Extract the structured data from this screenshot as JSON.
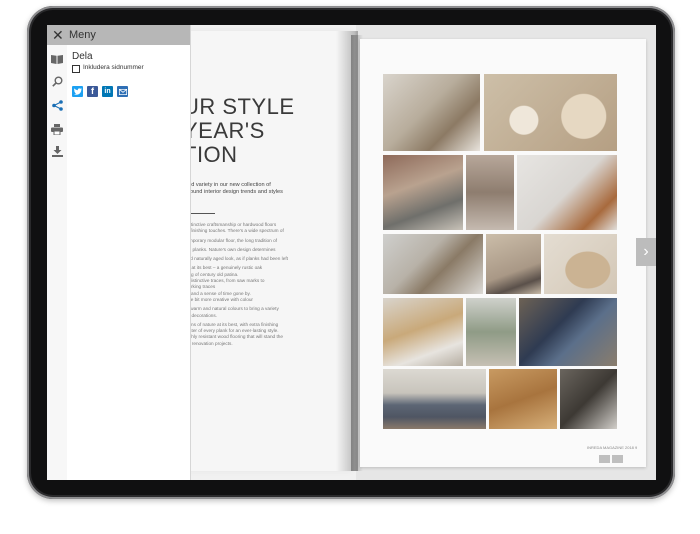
{
  "menu": {
    "title": "Meny",
    "close_icon": "close-icon",
    "section_title": "Dela",
    "checkbox_label": "Inkludera sidnummer",
    "checkbox_checked": false,
    "side_icons": [
      "book-icon",
      "search-icon",
      "share-icon",
      "print-icon",
      "download-icon"
    ],
    "share_buttons": [
      {
        "icon": "twitter-icon",
        "color": "#1da1f2"
      },
      {
        "icon": "facebook-icon",
        "color": "#3b5998"
      },
      {
        "icon": "linkedin-icon",
        "color": "#0077b5"
      },
      {
        "icon": "email-icon",
        "color": "#2f6fb5"
      }
    ],
    "accent_color": "#1a6fb5"
  },
  "left_page": {
    "headline": "UR STYLE\nYEAR'S\nTION",
    "intro": "and variety in our new collection of\naround interior design trends and styles",
    "paragraphs": [
      "distinctive craftsmanship or hardwood floors\nof finishing touches. There's a wide spectrum of",
      "temporary modular floor, the long tradition of",
      "ing planks. Nature's own design determines",
      "and naturally aged look, as if planks had been left",
      "ng at its best – a genuinely rustic oak\nking of century old patina.\nd distinctive traces, from saw marks to\nworking traces\nity and a sense of time gone by.\nlittle bit more creative with colour",
      "of warm and natural colours to bring a variety\nior decorations.",
      "signs of nature at its best, with extra finishing\nracter of every plank for an ever-lasting style.\nhighly resistant wood flooring that will stand the\nfor renovation projects."
    ]
  },
  "right_page": {
    "footer": "INREDA MAGAZINE 2018",
    "page_number": "9",
    "next_icon": "chevron-right-icon"
  }
}
